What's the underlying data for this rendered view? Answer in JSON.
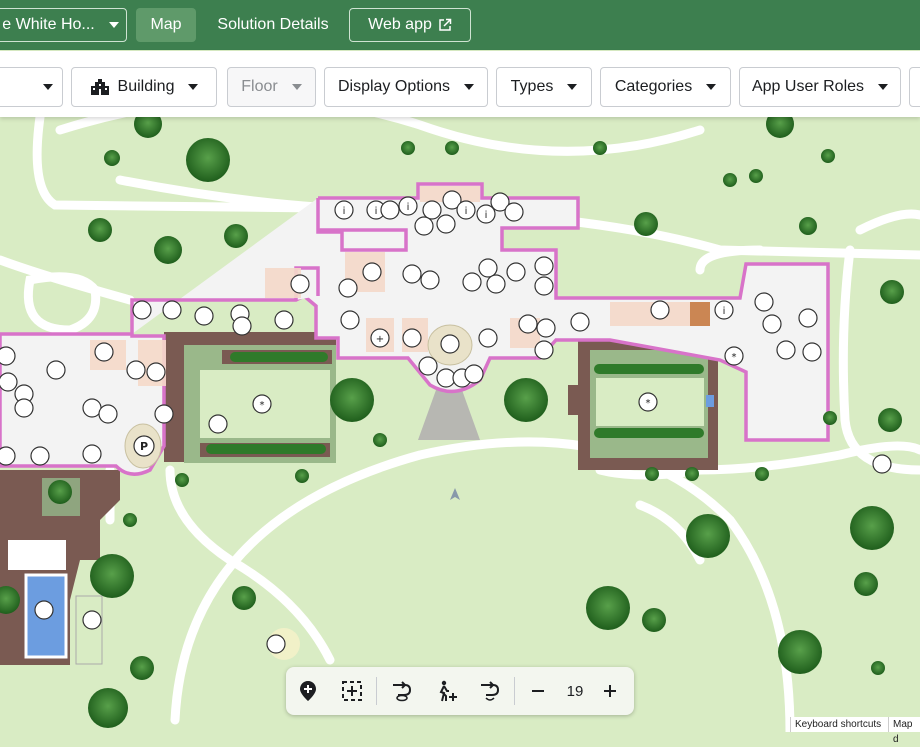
{
  "topbar": {
    "solution_label": "e White Ho...",
    "map_tab": "Map",
    "details_tab": "Solution Details",
    "webapp_label": "Web app"
  },
  "filters": {
    "building": "Building",
    "floor": "Floor",
    "display_options": "Display Options",
    "types": "Types",
    "categories": "Categories",
    "app_user_roles": "App User Roles"
  },
  "zoom": {
    "level": "19"
  },
  "attribution": {
    "shortcuts": "Keyboard shortcuts",
    "map_data": "Map d"
  },
  "colors": {
    "header": "#3d7f4f",
    "lawn": "#d9ecc4",
    "building_outline": "#d873c9",
    "path": "#ffffff",
    "tree": "#2f7a2a"
  },
  "icons": [
    "pin-add-icon",
    "area-select-icon",
    "route-icon",
    "walk-add-icon",
    "route-refresh-icon",
    "building-icon",
    "external-link-icon"
  ]
}
